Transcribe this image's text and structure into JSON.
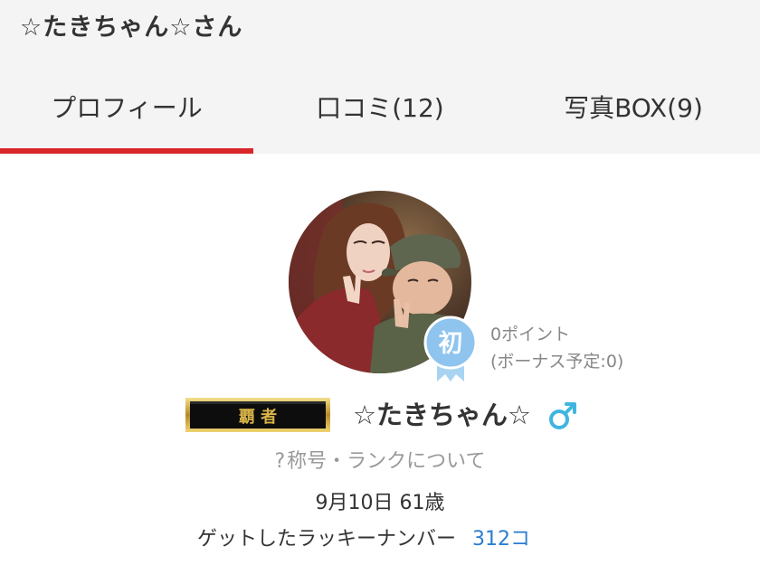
{
  "header": {
    "title": "☆たきちゃん☆さん"
  },
  "tabs": [
    {
      "label": "プロフィール",
      "active": true
    },
    {
      "label": "口コミ(12)",
      "active": false
    },
    {
      "label": "写真BOX(9)",
      "active": false
    }
  ],
  "profile": {
    "badge_label": "初",
    "points": "0ポイント",
    "bonus": "(ボーナス予定:0)",
    "rank_plate": "覇 者",
    "username": "☆たきちゃん☆",
    "gender_icon": "male-symbol-icon",
    "rank_help_mark": "?",
    "rank_help": "称号・ランクについて",
    "birth_and_age": "9月10日 61歳",
    "lucky_label": "ゲットしたラッキーナンバー",
    "lucky_count": "312コ"
  },
  "colors": {
    "accent": "#d9262a",
    "link": "#2a7dd1",
    "gender": "#3fb5e0",
    "badge": "#8ec4ee",
    "header_bg": "#f4f4f4"
  }
}
